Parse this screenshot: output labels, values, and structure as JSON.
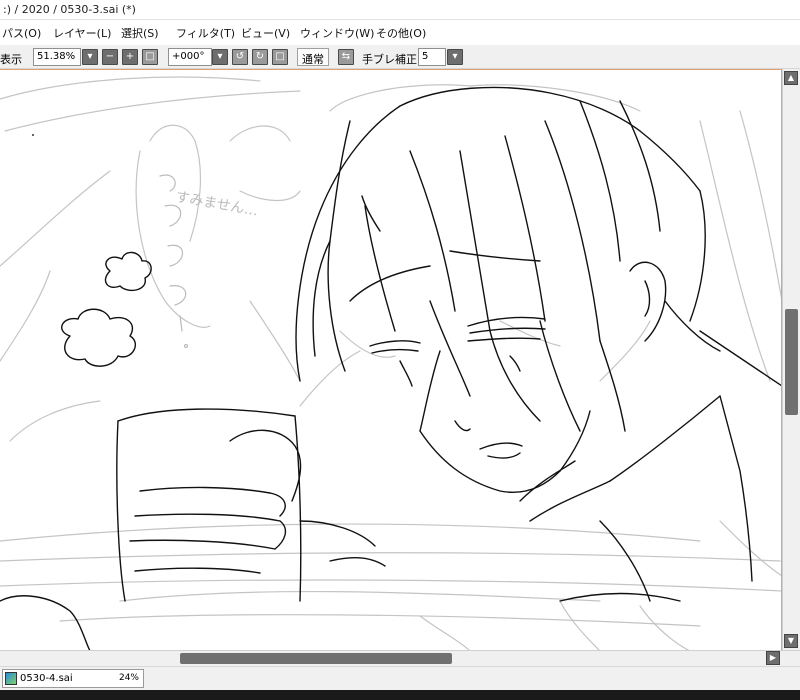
{
  "window": {
    "title": ":) / 2020 / 0530-3.sai (*)"
  },
  "menu": [
    {
      "label": "パス(O)"
    },
    {
      "label": "レイヤー(L)"
    },
    {
      "label": "選択(S)"
    },
    {
      "label": "フィルタ(T)"
    },
    {
      "label": "ビュー(V)"
    },
    {
      "label": "ウィンドウ(W)"
    },
    {
      "label": "その他(O)"
    }
  ],
  "toolbar": {
    "view_label": "表示",
    "zoom_value": "51.38%",
    "rotation_value": "+000°",
    "blend_label": "通常",
    "stabilizer_label": "手ブレ補正",
    "stabilizer_value": "5"
  },
  "canvas": {
    "speech_text": "すみません…"
  },
  "filebar": {
    "file_name": "0530-4.sai",
    "file_zoom": "24%"
  },
  "colors": {
    "canvas_border": "#e0a070",
    "scroll_thumb": "#707070",
    "sketch_gray": "#bbbbbb",
    "ink": "#111111"
  }
}
